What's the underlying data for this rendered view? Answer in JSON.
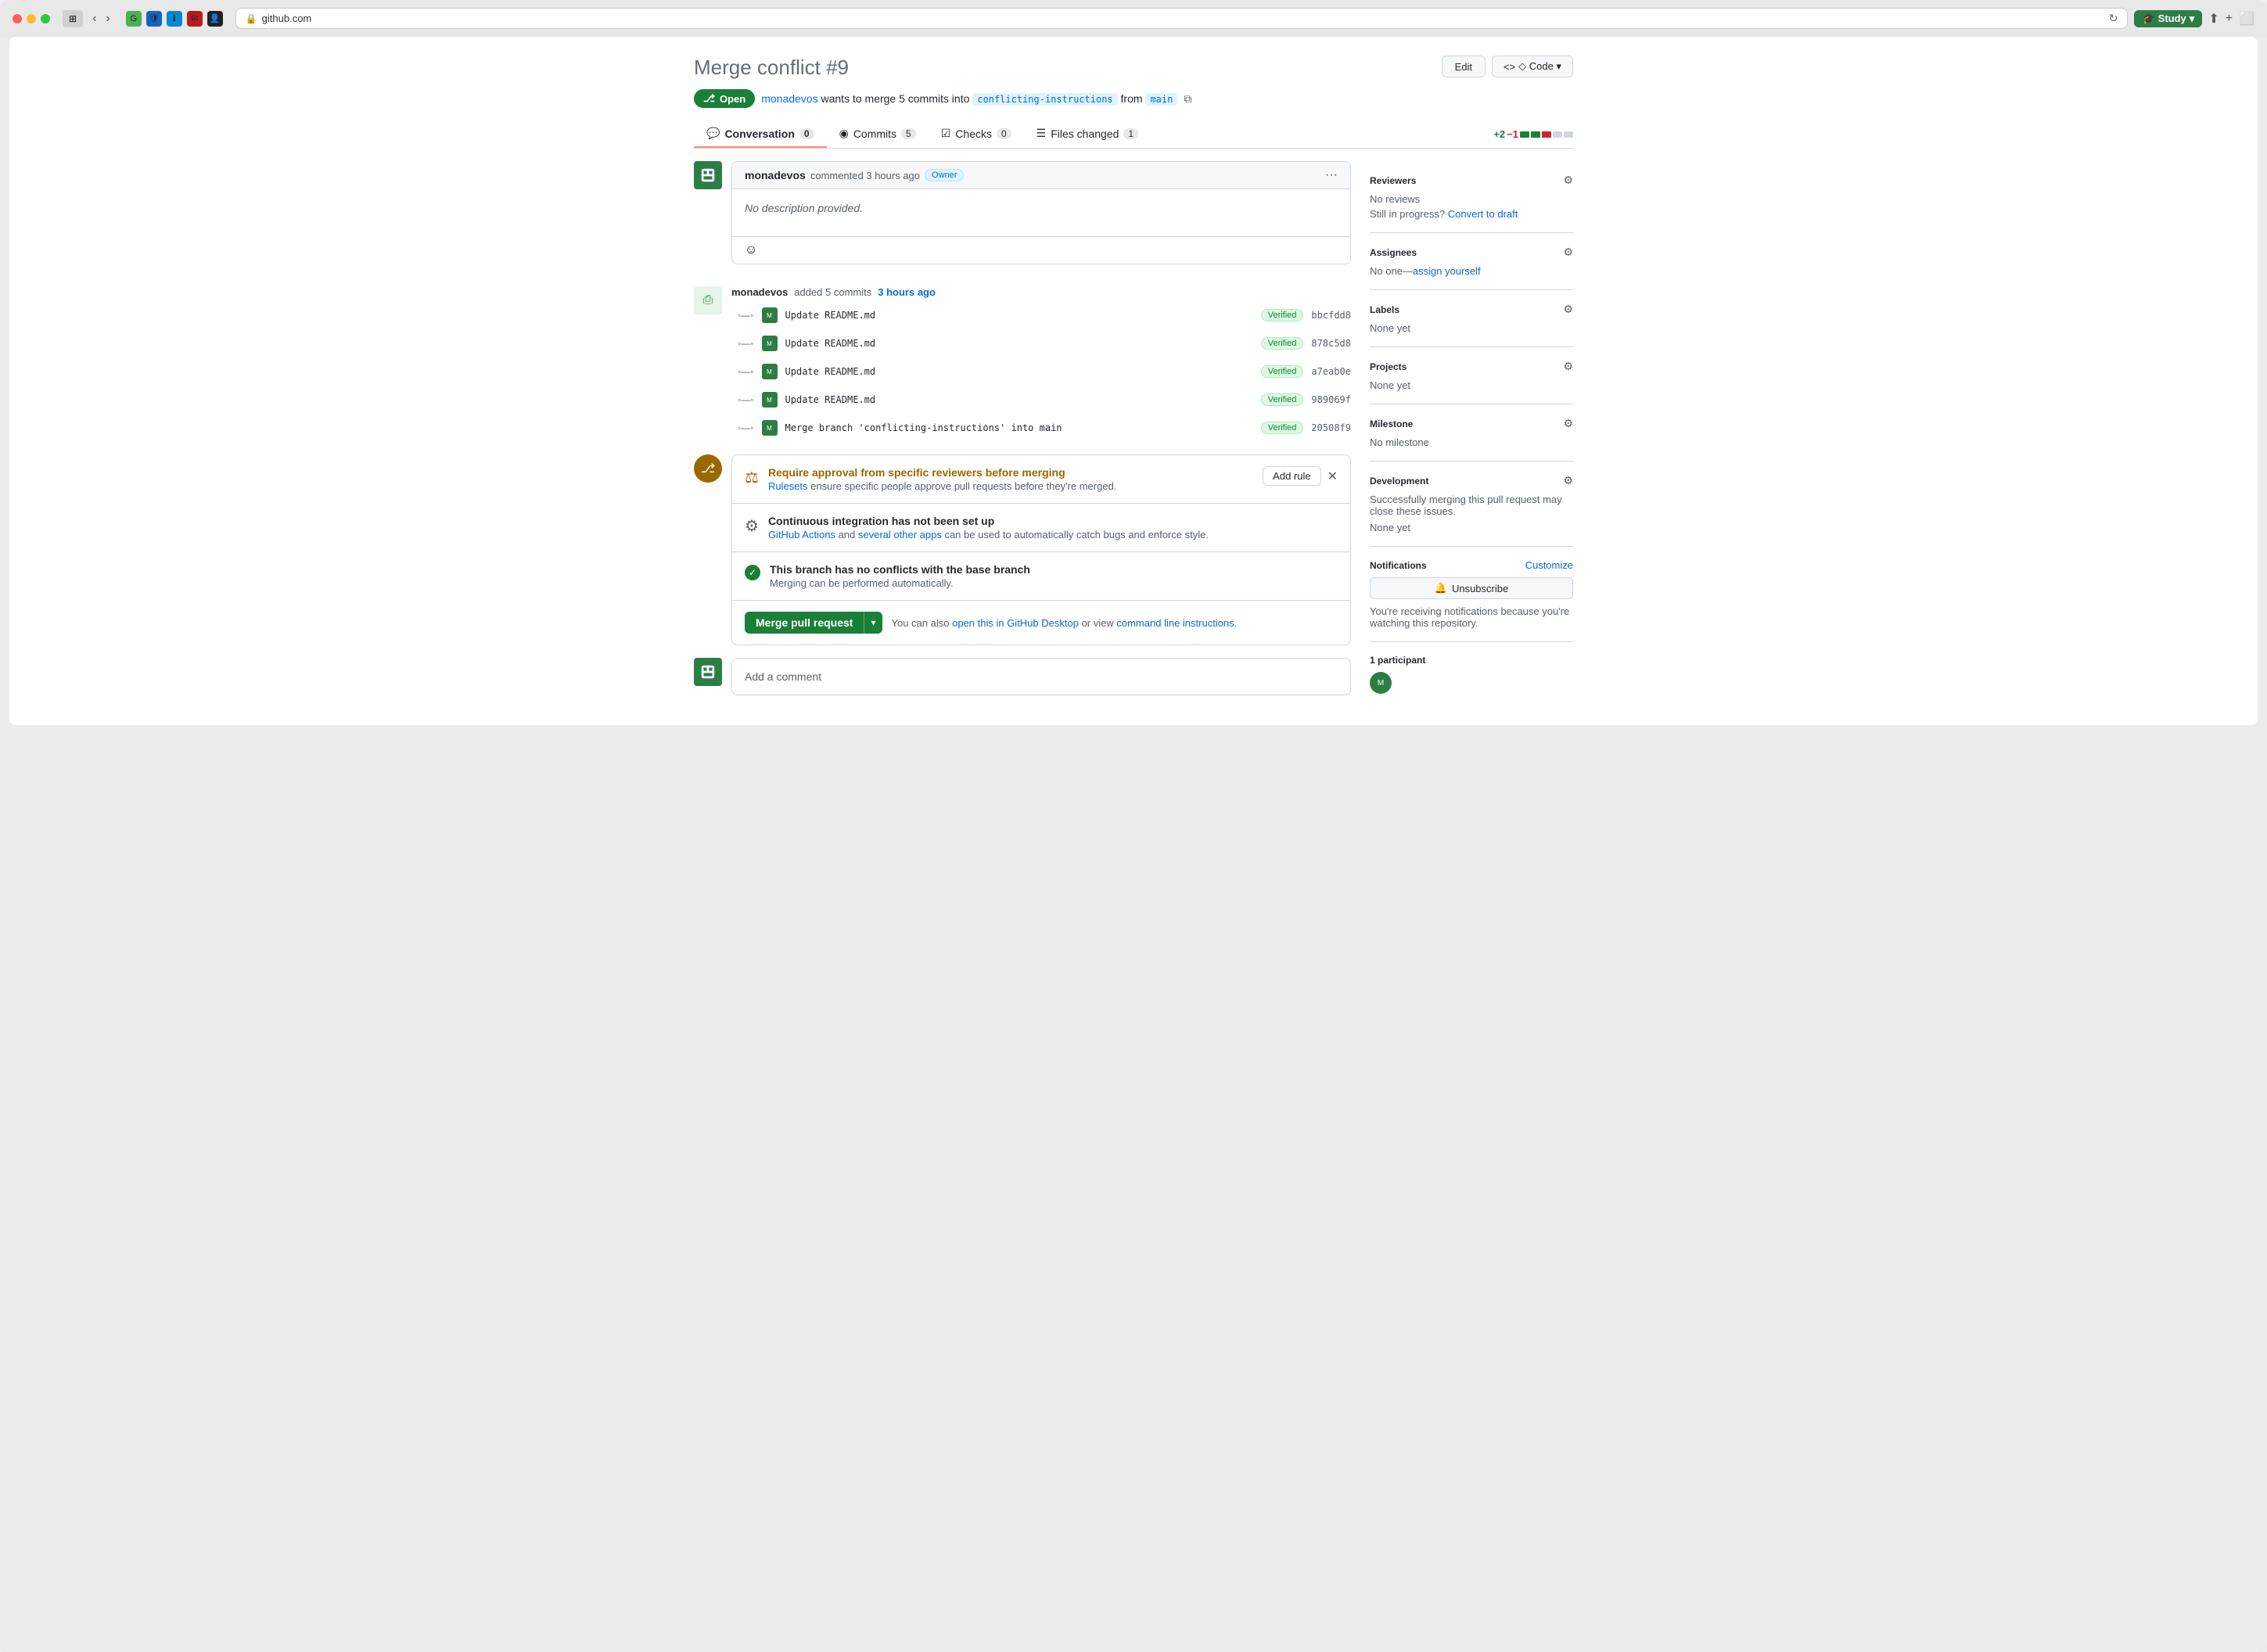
{
  "browser": {
    "traffic_lights": [
      "red",
      "yellow",
      "green"
    ],
    "study_label": "Study",
    "url": "github.com",
    "back_disabled": false,
    "forward_disabled": false
  },
  "page": {
    "title": "Merge conflict",
    "pr_number": "#9",
    "edit_label": "Edit",
    "code_label": "◇ Code ▾",
    "status_badge": "Open",
    "meta_text_1": "monadevos",
    "meta_text_2": " wants to merge ",
    "meta_text_3": "5 commits",
    "meta_text_4": " into ",
    "branch_target": "conflicting-instructions",
    "meta_text_5": " from ",
    "branch_source": "main"
  },
  "tabs": [
    {
      "label": "Conversation",
      "icon": "💬",
      "count": "0",
      "active": true
    },
    {
      "label": "Commits",
      "icon": "◉",
      "count": "5",
      "active": false
    },
    {
      "label": "Checks",
      "icon": "☑",
      "count": "0",
      "active": false
    },
    {
      "label": "Files changed",
      "icon": "☰",
      "count": "1",
      "active": false
    }
  ],
  "diff_stats": {
    "add": "+2",
    "remove": "−1"
  },
  "comment": {
    "author": "monadevos",
    "action": "commented",
    "time": "3 hours ago",
    "owner_badge": "Owner",
    "body": "No description provided.",
    "emoji_btn": "☺"
  },
  "commits_section": {
    "author": "monadevos",
    "action_text": "added 5 commits",
    "time_link": "3 hours ago",
    "items": [
      {
        "msg": "Update README.md",
        "badge": "Verified",
        "hash": "bbcfdd8"
      },
      {
        "msg": "Update README.md",
        "badge": "Verified",
        "hash": "878c5d8"
      },
      {
        "msg": "Update README.md",
        "badge": "Verified",
        "hash": "a7eab0e"
      },
      {
        "msg": "Update README.md",
        "badge": "Verified",
        "hash": "989069f"
      },
      {
        "msg": "Merge branch 'conflicting-instructions' into main",
        "badge": "Verified",
        "hash": "20508f9"
      }
    ]
  },
  "checks": [
    {
      "type": "warning",
      "icon": "⚖",
      "title": "Require approval from specific reviewers before merging",
      "desc_text": "ensure specific people approve pull requests before they're merged.",
      "desc_link_text": "Rulesets",
      "has_add_rule": true,
      "has_close": true
    },
    {
      "type": "info",
      "icon": "⚙",
      "title": "Continuous integration has not been set up",
      "desc_text": " and ",
      "desc_link1": "GitHub Actions",
      "desc_link2": "several other apps",
      "desc_suffix": " can be used to automatically catch bugs and enforce style.",
      "has_add_rule": false,
      "has_close": false
    },
    {
      "type": "success",
      "icon": "✓",
      "title": "This branch has no conflicts with the base branch",
      "desc": "Merging can be performed automatically.",
      "has_add_rule": false,
      "has_close": false
    }
  ],
  "merge": {
    "merge_btn_label": "Merge pull request",
    "also_text": "You can also",
    "link1": "open this in GitHub Desktop",
    "or_text": " or view ",
    "link2": "command line instructions",
    "period": "."
  },
  "sidebar": {
    "reviewers": {
      "title": "Reviewers",
      "no_reviews": "No reviews",
      "still_in_progress": "Still in progress?",
      "convert_link": "Convert to draft"
    },
    "assignees": {
      "title": "Assignees",
      "value": "No one—",
      "assign_link": "assign yourself"
    },
    "labels": {
      "title": "Labels",
      "value": "None yet"
    },
    "projects": {
      "title": "Projects",
      "value": "None yet"
    },
    "milestone": {
      "title": "Milestone",
      "value": "No milestone"
    },
    "development": {
      "title": "Development",
      "desc": "Successfully merging this pull request may close these issues.",
      "value": "None yet"
    },
    "notifications": {
      "title": "Notifications",
      "customize_label": "Customize",
      "unsubscribe_label": "Unsubscribe",
      "watching_text": "You're receiving notifications because you're watching this repository."
    },
    "participants": {
      "title": "1 participant"
    }
  },
  "add_comment": {
    "placeholder": "Add a comment"
  }
}
